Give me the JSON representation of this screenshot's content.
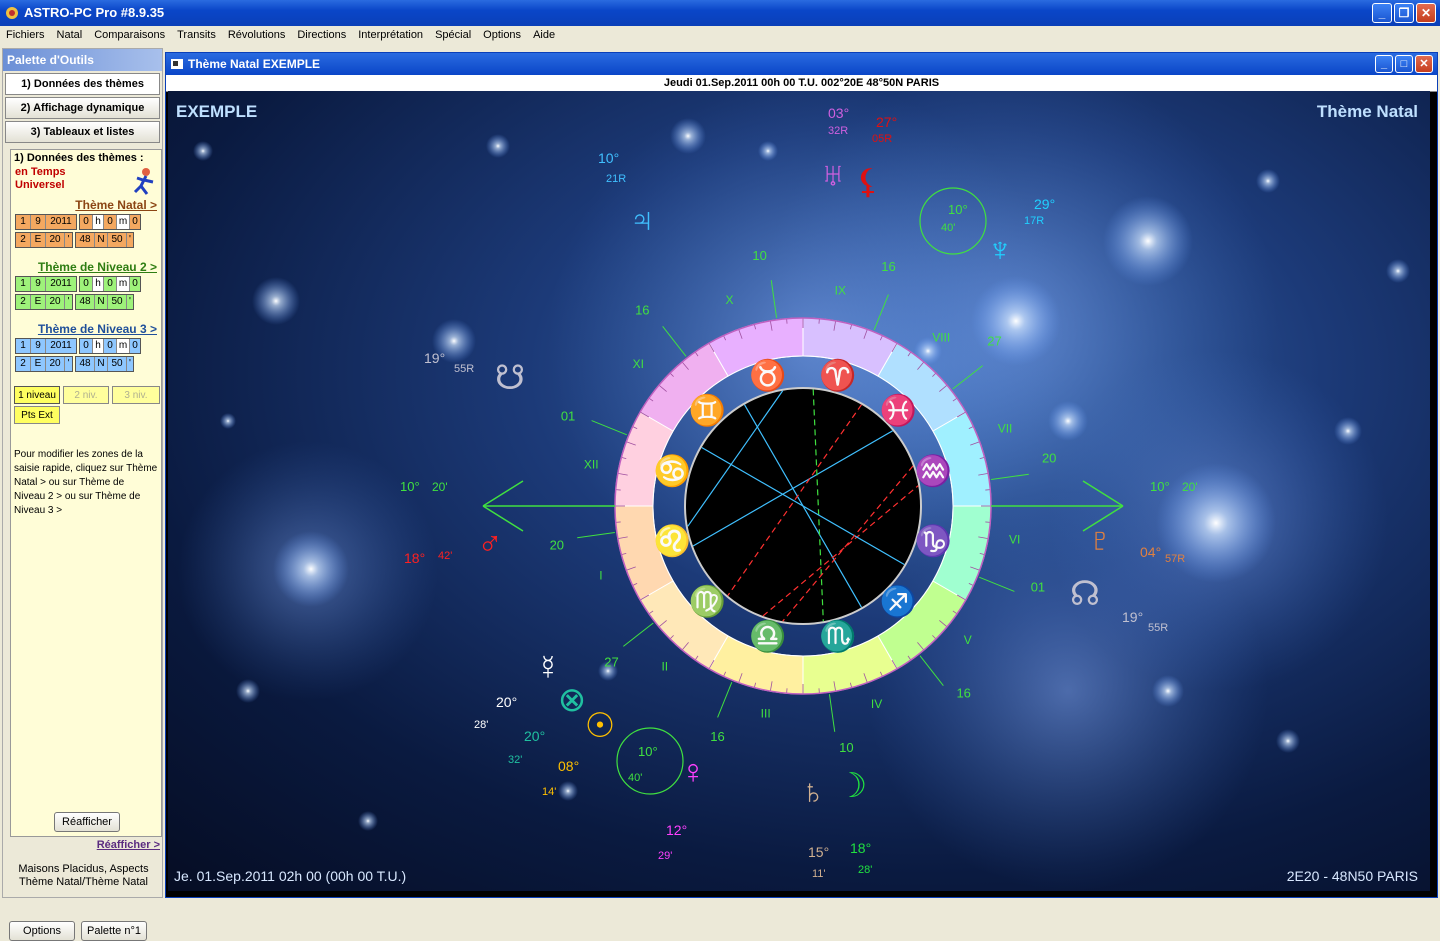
{
  "app": {
    "title": "ASTRO-PC Pro #8.9.35"
  },
  "menu": [
    "Fichiers",
    "Natal",
    "Comparaisons",
    "Transits",
    "Révolutions",
    "Directions",
    "Interprétation",
    "Spécial",
    "Options",
    "Aide"
  ],
  "palette": {
    "title": "Palette d'Outils",
    "tabs": [
      "1) Données des thèmes",
      "2) Affichage dynamique",
      "3) Tableaux et listes"
    ],
    "section_title": "1) Données des thèmes :",
    "time_line1": "en Temps",
    "time_line2": "Universel",
    "themes": [
      {
        "label": "Thème Natal >",
        "color": "#8b4513",
        "bg": "#f4a860",
        "date": [
          "1",
          "9",
          "2011"
        ],
        "time": [
          "0",
          "h",
          "0",
          "m",
          "0"
        ],
        "geo1": [
          "2",
          "E",
          "20",
          "'"
        ],
        "geo2": [
          "48",
          "N",
          "50",
          "'"
        ]
      },
      {
        "label": "Thème de Niveau 2 >",
        "color": "#2e7d12",
        "bg": "#9ef27a",
        "date": [
          "1",
          "9",
          "2011"
        ],
        "time": [
          "0",
          "h",
          "0",
          "m",
          "0"
        ],
        "geo1": [
          "2",
          "E",
          "20",
          "'"
        ],
        "geo2": [
          "48",
          "N",
          "50",
          "'"
        ]
      },
      {
        "label": "Thème de Niveau 3 >",
        "color": "#1f4f9a",
        "bg": "#8ec7ff",
        "date": [
          "1",
          "9",
          "2011"
        ],
        "time": [
          "0",
          "h",
          "0",
          "m",
          "0"
        ],
        "geo1": [
          "2",
          "E",
          "20",
          "'"
        ],
        "geo2": [
          "48",
          "N",
          "50",
          "'"
        ]
      }
    ],
    "levels": [
      "1 niveau",
      "2 niv.",
      "3 niv."
    ],
    "pts_ext": "Pts Ext",
    "help": "Pour modifier les zones de la saisie rapide, cliquez sur Thème Natal > ou sur Thème de Niveau 2 > ou sur Thème de Niveau 3 >",
    "refresh_button": "Réafficher",
    "refresh_link": "Réafficher >",
    "note_line1": "Maisons Placidus, Aspects",
    "note_line2": "Thème Natal/Thème Natal",
    "options_button": "Options",
    "palette_button": "Palette n°1"
  },
  "window": {
    "title": "Thème Natal  EXEMPLE",
    "info": "Jeudi 01.Sep.2011 00h 00 T.U. 002°20E 48°50N  PARIS"
  },
  "chart": {
    "name": "EXEMPLE",
    "type_label": "Thème Natal",
    "footer_left": "Je. 01.Sep.2011 02h 00 (00h 00 T.U.)",
    "footer_right": "2E20 - 48N50  PARIS",
    "signs": [
      "♈",
      "♉",
      "♊",
      "♋",
      "♌",
      "♍",
      "♎",
      "♏",
      "♐",
      "♑",
      "♒",
      "♓"
    ],
    "houses": [
      "I",
      "II",
      "III",
      "IV",
      "V",
      "VI",
      "VII",
      "VIII",
      "IX",
      "X",
      "XI",
      "XII"
    ],
    "cusp_degrees": [
      "20",
      "27",
      "16",
      "10",
      "16",
      "01",
      "20",
      "27",
      "16",
      "10",
      "16",
      "01"
    ],
    "axis_left": {
      "deg": "10°",
      "min": "20'"
    },
    "axis_right": {
      "deg": "10°",
      "min": "20'"
    },
    "circle_top": {
      "deg": "10°",
      "min": "40'"
    },
    "circle_bottom": {
      "deg": "10°",
      "min": "40'"
    },
    "planets": [
      {
        "name": "uranus",
        "glyph": "♅",
        "deg": "03°",
        "min": "32R",
        "color": "#d060e0"
      },
      {
        "name": "lilith",
        "glyph": "⚸",
        "deg": "27°",
        "min": "05R",
        "color": "#e01010"
      },
      {
        "name": "jupiter",
        "glyph": "♃",
        "deg": "10°",
        "min": "21R",
        "color": "#40c0ff"
      },
      {
        "name": "neptune",
        "glyph": "♆",
        "deg": "29°",
        "min": "17R",
        "color": "#20d0ff"
      },
      {
        "name": "south-node",
        "glyph": "☋",
        "deg": "19°",
        "min": "55R",
        "color": "#c0c0d0"
      },
      {
        "name": "pluto",
        "glyph": "♇",
        "deg": "04°",
        "min": "57R",
        "color": "#e08040"
      },
      {
        "name": "north-node",
        "glyph": "☊",
        "deg": "19°",
        "min": "55R",
        "color": "#c0c0d0"
      },
      {
        "name": "mars",
        "glyph": "♂",
        "deg": "18°",
        "min": "42'",
        "color": "#ff2020"
      },
      {
        "name": "mercury",
        "glyph": "☿",
        "deg": "20°",
        "min": "28'",
        "color": "#ffffff"
      },
      {
        "name": "fortune",
        "glyph": "⊗",
        "deg": "20°",
        "min": "32'",
        "color": "#20c0a0"
      },
      {
        "name": "sun",
        "glyph": "☉",
        "deg": "08°",
        "min": "14'",
        "color": "#ffc000"
      },
      {
        "name": "venus",
        "glyph": "♀",
        "deg": "12°",
        "min": "29'",
        "color": "#ff40ff"
      },
      {
        "name": "saturn",
        "glyph": "♄",
        "deg": "15°",
        "min": "11'",
        "color": "#d0b090"
      },
      {
        "name": "moon",
        "glyph": "☽",
        "deg": "18°",
        "min": "28'",
        "color": "#20e040"
      }
    ]
  }
}
